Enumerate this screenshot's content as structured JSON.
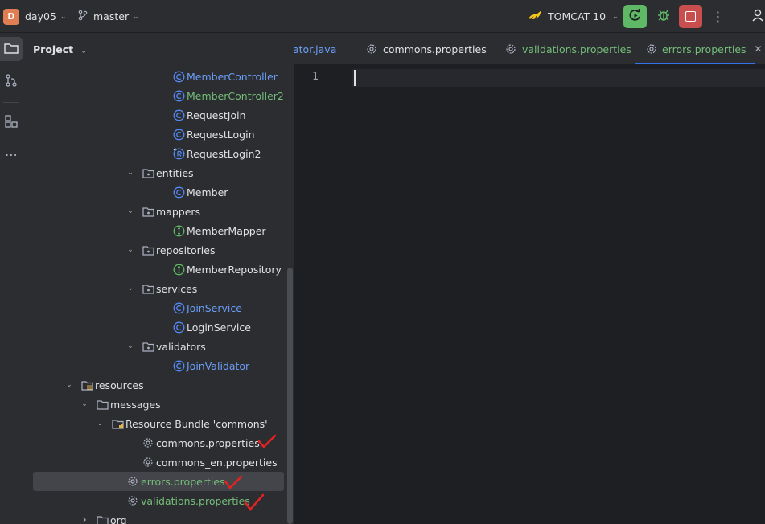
{
  "topbar": {
    "project_initial": "D",
    "project_name": "day05",
    "branch": "master",
    "run_config": "TOMCAT 10",
    "colors": {
      "run_green": "#5fb865",
      "stop_red": "#c94f4f",
      "accent": "#3574f0"
    }
  },
  "panel": {
    "title": "Project"
  },
  "tree": [
    {
      "label": "MemberController",
      "icon": "class-icon",
      "color": "blue"
    },
    {
      "label": "MemberController2",
      "icon": "class-icon",
      "color": "green"
    },
    {
      "label": "RequestJoin",
      "icon": "class-icon",
      "color": "default"
    },
    {
      "label": "RequestLogin",
      "icon": "class-icon",
      "color": "default"
    },
    {
      "label": "RequestLogin2",
      "icon": "record-icon",
      "color": "default"
    },
    {
      "label": "entities",
      "icon": "package-icon",
      "color": "default"
    },
    {
      "label": "Member",
      "icon": "class-icon",
      "color": "default"
    },
    {
      "label": "mappers",
      "icon": "package-icon",
      "color": "default"
    },
    {
      "label": "MemberMapper",
      "icon": "interface-icon",
      "color": "default"
    },
    {
      "label": "repositories",
      "icon": "package-icon",
      "color": "default"
    },
    {
      "label": "MemberRepository",
      "icon": "interface-icon",
      "color": "default"
    },
    {
      "label": "services",
      "icon": "package-icon",
      "color": "default"
    },
    {
      "label": "JoinService",
      "icon": "class-icon",
      "color": "blue"
    },
    {
      "label": "LoginService",
      "icon": "class-icon",
      "color": "default"
    },
    {
      "label": "validators",
      "icon": "package-icon",
      "color": "default"
    },
    {
      "label": "JoinValidator",
      "icon": "class-icon",
      "color": "blue"
    },
    {
      "label": "resources",
      "icon": "resources-folder-icon",
      "color": "default"
    },
    {
      "label": "messages",
      "icon": "folder-icon",
      "color": "default"
    },
    {
      "label": "Resource Bundle 'commons'",
      "icon": "resource-bundle-icon",
      "color": "default"
    },
    {
      "label": "commons.properties",
      "icon": "properties-gear-icon",
      "color": "default"
    },
    {
      "label": "commons_en.properties",
      "icon": "properties-gear-icon",
      "color": "default"
    },
    {
      "label": "errors.properties",
      "icon": "properties-gear-icon",
      "color": "green"
    },
    {
      "label": "validations.properties",
      "icon": "properties-gear-icon",
      "color": "green"
    },
    {
      "label": "org",
      "icon": "folder-icon",
      "color": "default"
    }
  ],
  "tabs": [
    {
      "label": "ator.java",
      "color": "blue"
    },
    {
      "label": "commons.properties",
      "color": "default"
    },
    {
      "label": "validations.properties",
      "color": "green"
    },
    {
      "label": "errors.properties",
      "color": "green",
      "active": true
    }
  ],
  "editor": {
    "line_numbers": [
      "1"
    ]
  }
}
